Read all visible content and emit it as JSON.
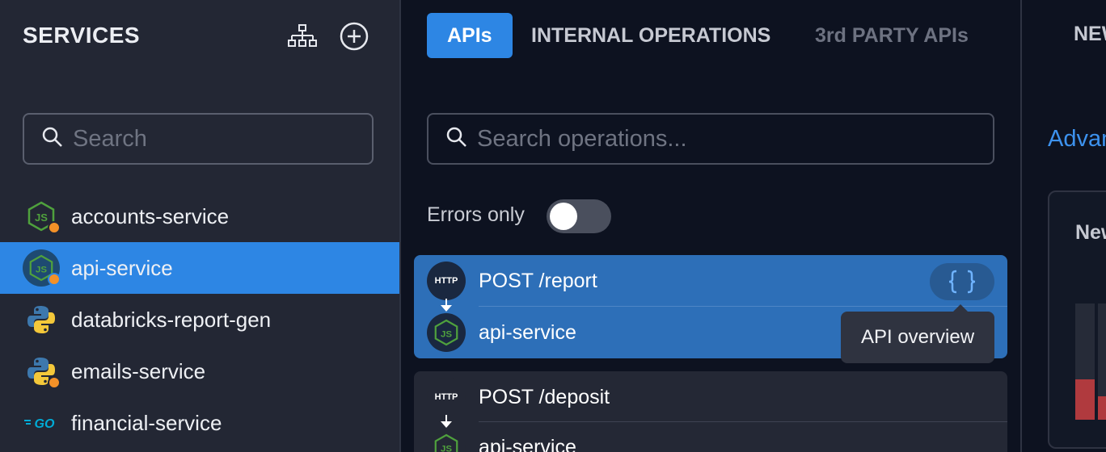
{
  "sidebar": {
    "title": "SERVICES",
    "search_placeholder": "Search",
    "items": [
      {
        "label": "accounts-service",
        "icon": "nodejs-icon",
        "status_dot": true,
        "active": false
      },
      {
        "label": "api-service",
        "icon": "nodejs-icon",
        "status_dot": true,
        "active": true
      },
      {
        "label": "databricks-report-gen",
        "icon": "python-icon",
        "status_dot": false,
        "active": false
      },
      {
        "label": "emails-service",
        "icon": "python-icon",
        "status_dot": true,
        "active": false
      },
      {
        "label": "financial-service",
        "icon": "go-icon",
        "status_dot": false,
        "active": false
      }
    ]
  },
  "operations": {
    "tabs": [
      {
        "label": "APIs",
        "state": "active"
      },
      {
        "label": "INTERNAL OPERATIONS",
        "state": "inactive"
      },
      {
        "label": "3rd PARTY APIs",
        "state": "muted"
      }
    ],
    "search_placeholder": "Search operations...",
    "errors_only_label": "Errors only",
    "errors_only_enabled": false,
    "cards": [
      {
        "badge": "HTTP",
        "operation": "POST /report",
        "service": "api-service",
        "selected": true
      },
      {
        "badge": "HTTP",
        "operation": "POST /deposit",
        "service": "api-service",
        "selected": false
      }
    ],
    "tooltip": "API overview"
  },
  "right_panel": {
    "tab_label": "NEW",
    "link_label": "Advanced",
    "card_title": "New",
    "bars": [
      {
        "fill_fraction": 0.35
      },
      {
        "fill_fraction": 0.2
      }
    ]
  },
  "colors": {
    "accent": "#2d86e4",
    "status_dot": "#f39128",
    "error_bar": "#b03a3e",
    "nodejs": "#4fa13d",
    "python_blue": "#3d78ad",
    "python_yellow": "#f4c83a",
    "go": "#00acd7"
  }
}
